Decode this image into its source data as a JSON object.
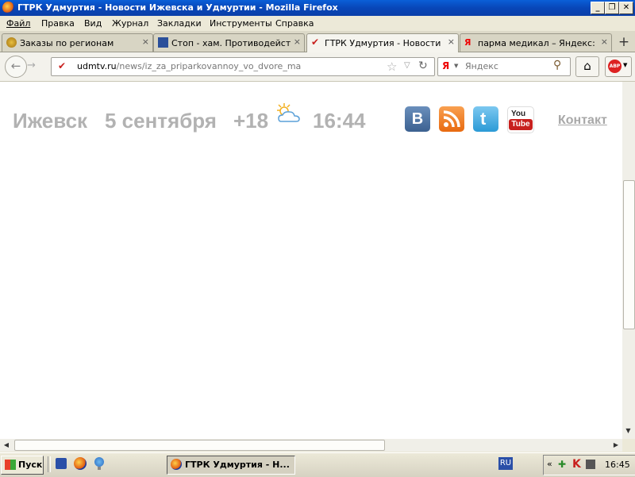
{
  "window": {
    "title": "ГТРК Удмуртия - Новости Ижевска и Удмуртии - Mozilla Firefox"
  },
  "menu": [
    "Файл",
    "Правка",
    "Вид",
    "Журнал",
    "Закладки",
    "Инструменты",
    "Справка"
  ],
  "tabs": [
    {
      "label": "Заказы по регионам",
      "icon": "emblem-icon",
      "active": false
    },
    {
      "label": "Стоп - хам. Противодействи...",
      "icon": "mail-icon",
      "active": false
    },
    {
      "label": "ГТРК Удмуртия - Новости И...",
      "icon": "udmtv-icon",
      "active": true
    },
    {
      "label": "парма медикал – Яндекс: н...",
      "icon": "yandex-icon",
      "active": false
    }
  ],
  "address": {
    "domain": "udmtv.ru",
    "path": "/news/iz_za_priparkovannoy_vo_dvore_ma"
  },
  "search": {
    "engine_letter": "Я",
    "placeholder": "Яндекс"
  },
  "page": {
    "city": "Ижевск",
    "date": "5 сентября",
    "temperature": "+18",
    "time": "16:44",
    "contacts_link": "Контакт",
    "social": [
      "vkontakte-icon",
      "rss-icon",
      "twitter-icon",
      "youtube-icon"
    ],
    "social_labels": {
      "vk": "В",
      "youtube_top": "You",
      "youtube_bottom": "Tube"
    }
  },
  "taskbar": {
    "start_label": "Пуск",
    "task_label": "ГТРК Удмуртия - Н...",
    "lang": "RU",
    "tray_expand": "«",
    "clock": "16:45"
  },
  "colors": {
    "header_text": "#b2b2b2",
    "xp_blue": "#0a5fd8",
    "vk": "#4a6f9c",
    "rss": "#f0832a",
    "twitter": "#40a8e0",
    "youtube": "#c8201e"
  }
}
